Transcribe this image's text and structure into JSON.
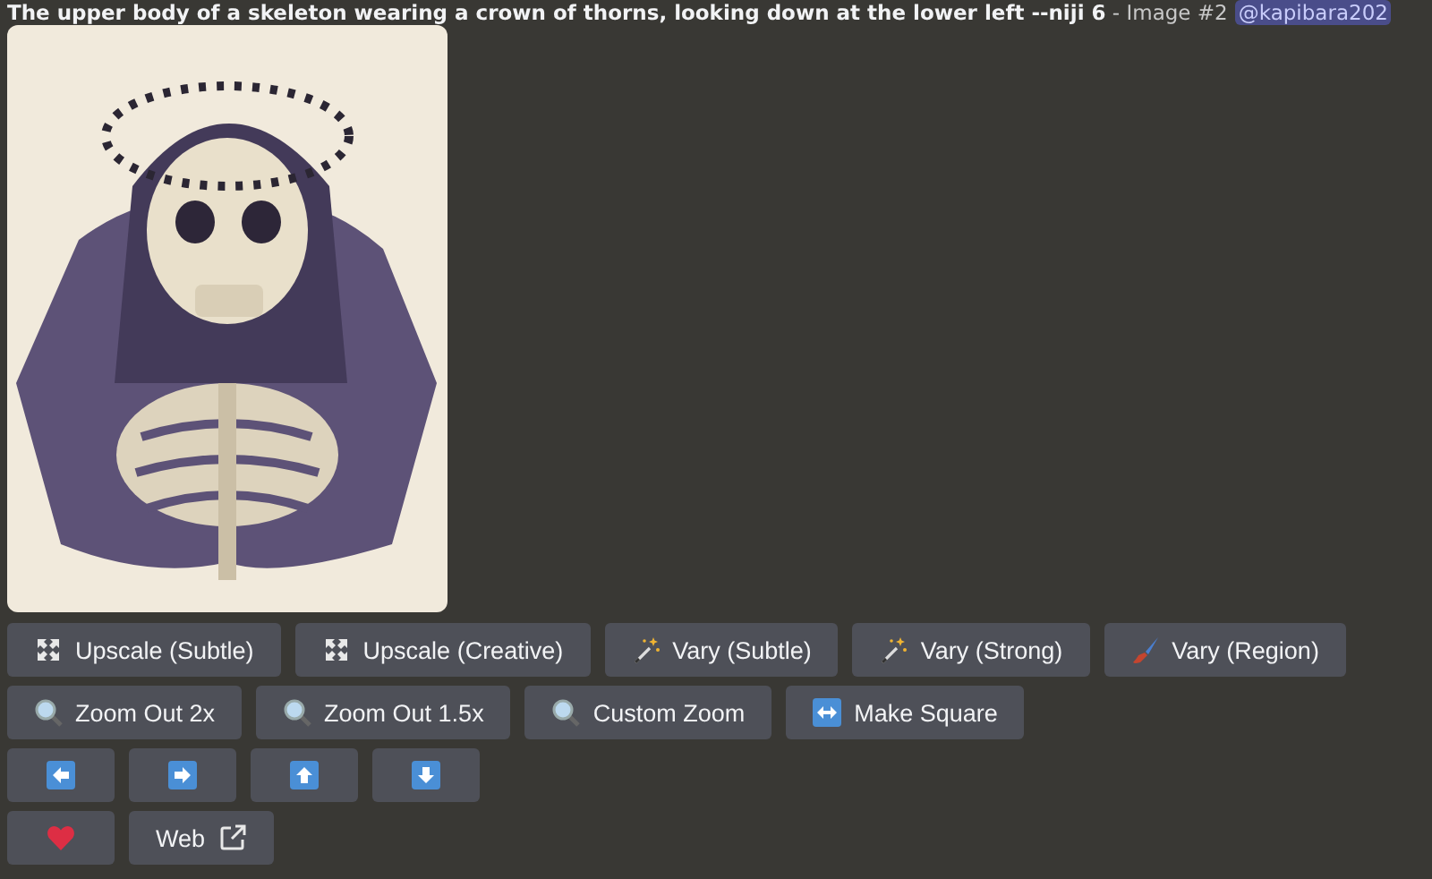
{
  "message": {
    "prompt": "The upper body of a skeleton wearing a crown of thorns, looking down at the lower left --niji 6",
    "suffix": " - Image #2",
    "mention": "@kapibara202"
  },
  "image": {
    "kind": "picture"
  },
  "button_rows": [
    [
      {
        "label": "Upscale (Subtle)",
        "kind": "upscale"
      },
      {
        "label": "Upscale (Creative)",
        "kind": "upscale"
      },
      {
        "label": "Vary (Subtle)",
        "kind": "wand"
      },
      {
        "label": "Vary (Strong)",
        "kind": "wand"
      },
      {
        "label": "Vary (Region)",
        "kind": "brush"
      }
    ],
    [
      {
        "label": "Zoom Out 2x",
        "kind": "zoom"
      },
      {
        "label": "Zoom Out 1.5x",
        "kind": "zoom"
      },
      {
        "label": "Custom Zoom",
        "kind": "zoom"
      },
      {
        "label": "Make Square",
        "kind": "square"
      }
    ],
    [
      {
        "kind": "left"
      },
      {
        "kind": "right"
      },
      {
        "kind": "up"
      },
      {
        "kind": "down"
      }
    ],
    [
      {
        "kind": "heart"
      },
      {
        "label": "Web",
        "kind": "link"
      }
    ]
  ]
}
